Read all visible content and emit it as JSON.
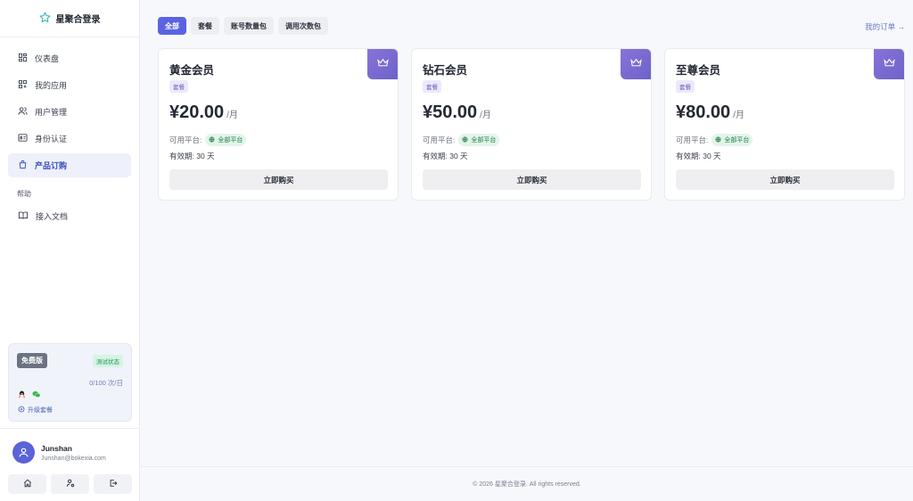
{
  "brand": {
    "title": "星聚合登录"
  },
  "sidebar": {
    "items": [
      {
        "label": "仪表盘",
        "icon": "dashboard-icon"
      },
      {
        "label": "我的应用",
        "icon": "apps-icon"
      },
      {
        "label": "用户管理",
        "icon": "users-icon"
      },
      {
        "label": "身份认证",
        "icon": "id-card-icon"
      },
      {
        "label": "产品订购",
        "icon": "shopping-bag-icon",
        "active": true
      }
    ],
    "help_section": "帮助",
    "help_items": [
      {
        "label": "接入文档",
        "icon": "book-icon"
      }
    ]
  },
  "plan": {
    "badge": "免费版",
    "status": "测试状态",
    "usage": "0/100 次/日",
    "upgrade": "升级套餐"
  },
  "user": {
    "name": "Junshan",
    "email": "Junshan@bokexia.com"
  },
  "tabs": [
    "全部",
    "套餐",
    "账号数量包",
    "调用次数包"
  ],
  "orders_link": "我的订单 →",
  "cards": [
    {
      "title": "黄金会员",
      "tag": "套餐",
      "price": "¥20.00",
      "unit": "/月",
      "platform_label": "可用平台:",
      "platform": "全部平台",
      "validity": "有效期: 30 天",
      "button": "立即购买"
    },
    {
      "title": "钻石会员",
      "tag": "套餐",
      "price": "¥50.00",
      "unit": "/月",
      "platform_label": "可用平台:",
      "platform": "全部平台",
      "validity": "有效期: 30 天",
      "button": "立即购买"
    },
    {
      "title": "至尊会员",
      "tag": "套餐",
      "price": "¥80.00",
      "unit": "/月",
      "platform_label": "可用平台:",
      "platform": "全部平台",
      "validity": "有效期: 30 天",
      "button": "立即购买"
    }
  ],
  "footer": "© 2026 星聚合登录. All rights reserved.",
  "colors": {
    "accent": "#5b63e2",
    "crown_gradient_start": "#8a72d8",
    "crown_gradient_end": "#6c63c9"
  }
}
